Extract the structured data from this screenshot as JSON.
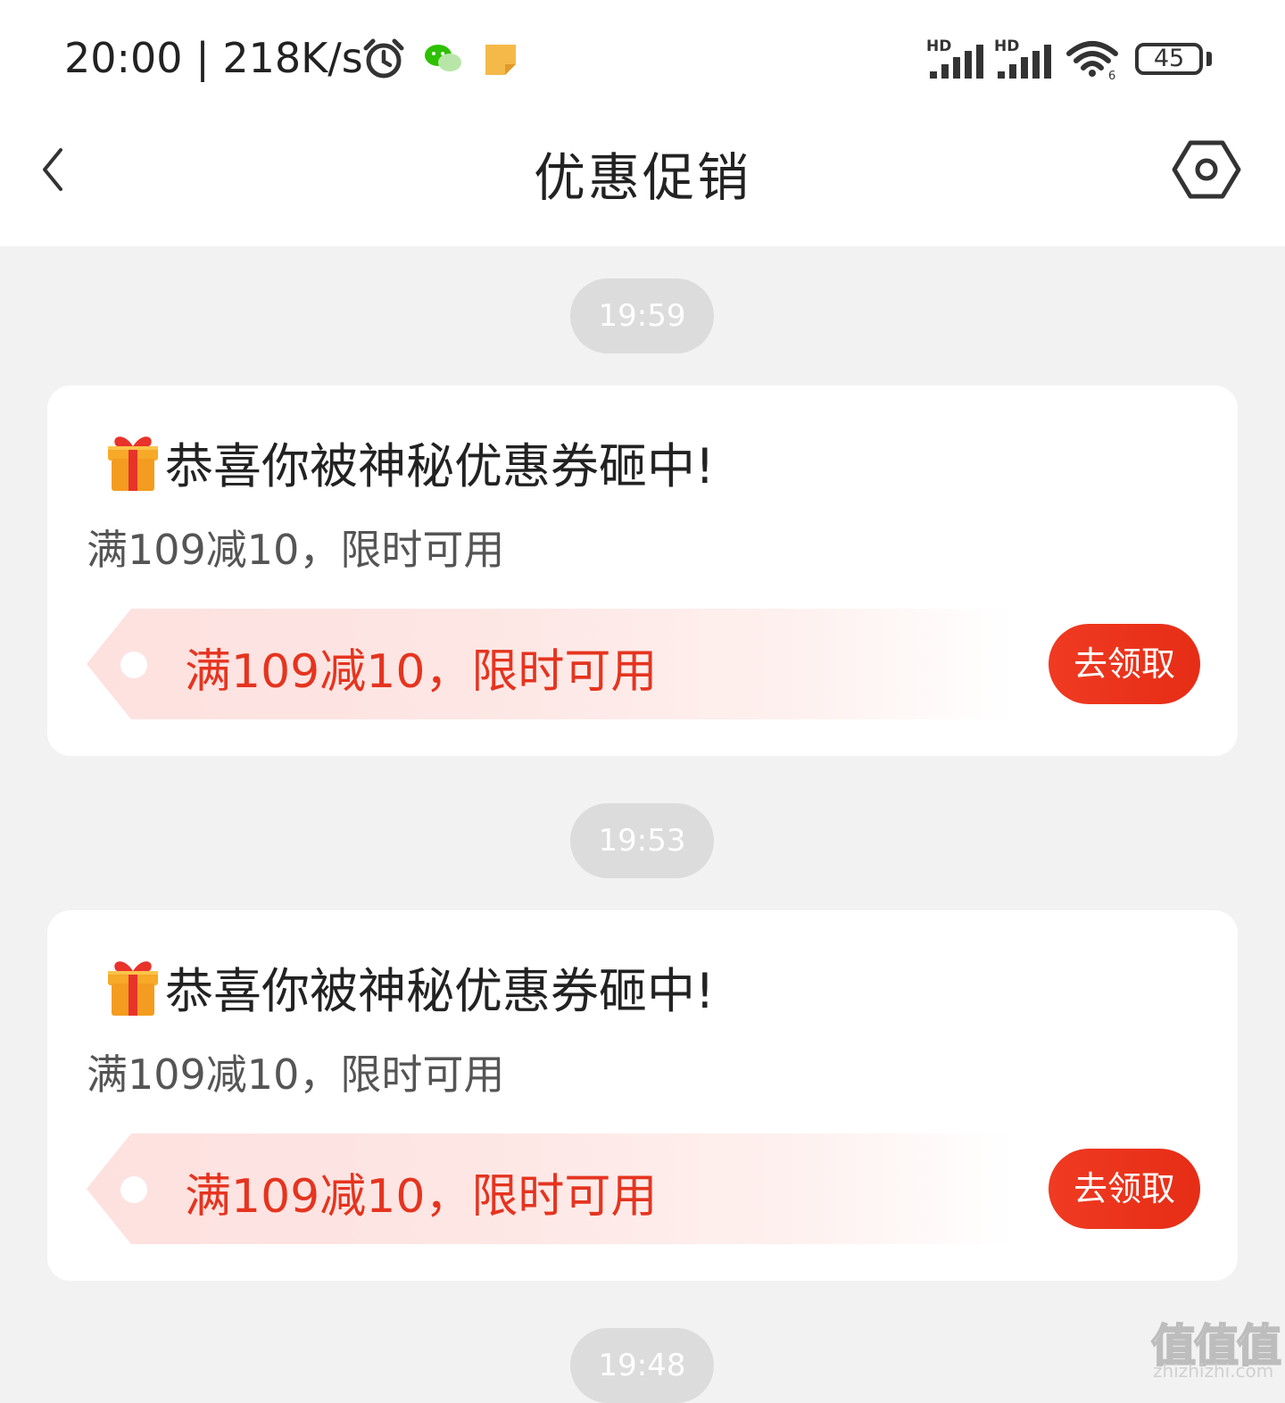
{
  "status_bar": {
    "time": "20:00",
    "separator": "|",
    "net_speed": "218K/s",
    "battery": "45",
    "signal_label_1": "HD",
    "signal_label_2": "HD"
  },
  "header": {
    "title": "优惠促销"
  },
  "feed": [
    {
      "time": "19:59",
      "title": "恭喜你被神秘优惠券砸中!",
      "subtitle": "满109减10，限时可用",
      "coupon_text": "满109减10，限时可用",
      "button_label": "去领取"
    },
    {
      "time": "19:53",
      "title": "恭喜你被神秘优惠券砸中!",
      "subtitle": "满109减10，限时可用",
      "coupon_text": "满109减10，限时可用",
      "button_label": "去领取"
    },
    {
      "time": "19:48"
    }
  ],
  "watermark": {
    "logo": "值值值",
    "url": "zhizhizhi.com"
  },
  "colors": {
    "accent_red": "#e5341f",
    "button_red": "#ea2f18",
    "coupon_bg": "#fde1df",
    "page_bg": "#f2f2f2"
  },
  "icons": [
    "alarm-icon",
    "wechat-icon",
    "note-icon",
    "signal-icon",
    "wifi-icon",
    "battery-icon",
    "back-icon",
    "settings-icon",
    "gift-icon"
  ]
}
